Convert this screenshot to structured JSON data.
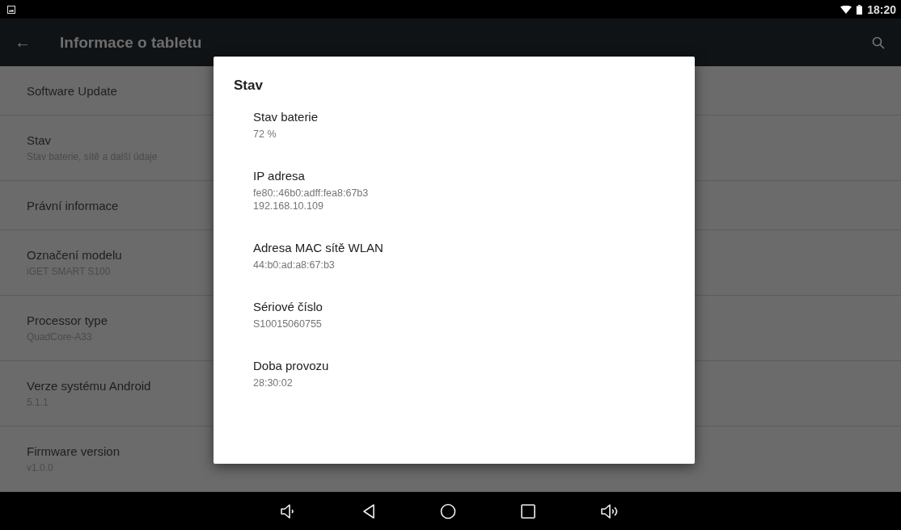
{
  "status_bar": {
    "time": "18:20"
  },
  "toolbar": {
    "back": "←",
    "title": "Informace o tabletu"
  },
  "settings_items": [
    {
      "title": "Software Update"
    },
    {
      "title": "Stav",
      "summary": "Stav baterie, sítě a další údaje"
    },
    {
      "title": "Právní informace"
    },
    {
      "title": "Označení modelu",
      "summary": "iGET SMART S100"
    },
    {
      "title": "Processor type",
      "summary": "QuadCore-A33"
    },
    {
      "title": "Verze systému Android",
      "summary": "5.1.1"
    },
    {
      "title": "Firmware version",
      "summary": "v1.0.0"
    }
  ],
  "dialog": {
    "title": "Stav",
    "items": [
      {
        "label": "Stav baterie",
        "values": [
          "72 %"
        ]
      },
      {
        "label": "IP adresa",
        "values": [
          "fe80::46b0:adff:fea8:67b3",
          "192.168.10.109"
        ]
      },
      {
        "label": "Adresa MAC sítě WLAN",
        "values": [
          "44:b0:ad:a8:67:b3"
        ]
      },
      {
        "label": "Sériové číslo",
        "values": [
          "S10015060755"
        ]
      },
      {
        "label": "Doba provozu",
        "values": [
          "28:30:02"
        ]
      }
    ]
  },
  "nav_bar": [
    {
      "kind": "volume-down"
    },
    {
      "kind": "back"
    },
    {
      "kind": "home"
    },
    {
      "kind": "recents"
    },
    {
      "kind": "volume-up"
    }
  ]
}
